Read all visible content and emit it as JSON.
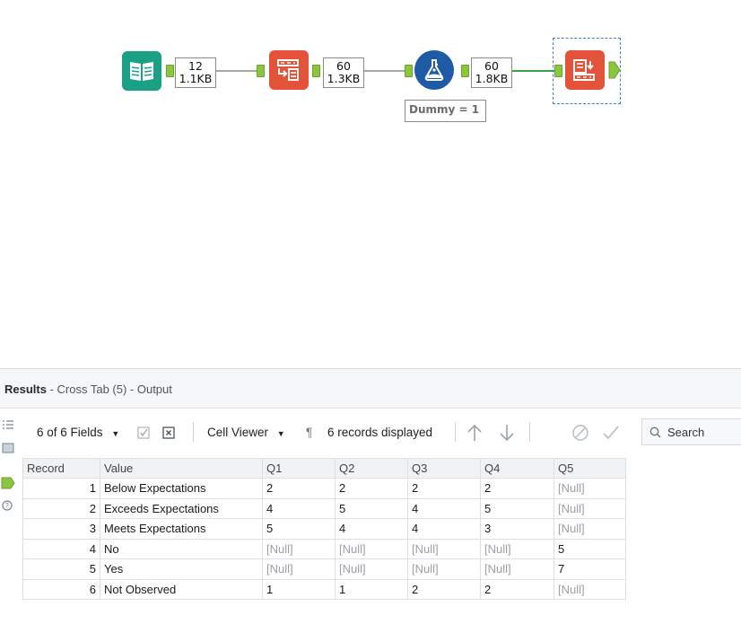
{
  "workflow": {
    "tools": [
      {
        "name": "Input Data",
        "icon": "book-icon",
        "color": "#1aa084"
      },
      {
        "name": "Cross Tab",
        "icon": "cross-tab-icon",
        "color": "#e2533a"
      },
      {
        "name": "Formula",
        "icon": "flask-icon",
        "color": "#1f5aa6"
      },
      {
        "name": "Cross Tab",
        "icon": "cross-tab-icon",
        "color": "#e2533a"
      }
    ],
    "badges": [
      {
        "records": "12",
        "size": "1.1KB"
      },
      {
        "records": "60",
        "size": "1.3KB"
      },
      {
        "records": "60",
        "size": "1.8KB"
      }
    ],
    "annotation": "Dummy = 1"
  },
  "results": {
    "title_bold": "Results",
    "title_rest": " - Cross Tab (5) - Output",
    "toolbar": {
      "fields": "6 of 6 Fields",
      "cell_viewer": "Cell Viewer",
      "pilcrow": "¶",
      "records_displayed": "6 records displayed",
      "search_placeholder": "Search"
    },
    "columns": [
      "Record",
      "Value",
      "Q1",
      "Q2",
      "Q3",
      "Q4",
      "Q5"
    ],
    "rows": [
      [
        "1",
        "Below Expectations",
        "2",
        "2",
        "2",
        "2",
        "[Null]"
      ],
      [
        "2",
        "Exceeds Expectations",
        "4",
        "5",
        "4",
        "5",
        "[Null]"
      ],
      [
        "3",
        "Meets Expectations",
        "5",
        "4",
        "4",
        "3",
        "[Null]"
      ],
      [
        "4",
        "No",
        "[Null]",
        "[Null]",
        "[Null]",
        "[Null]",
        "5"
      ],
      [
        "5",
        "Yes",
        "[Null]",
        "[Null]",
        "[Null]",
        "[Null]",
        "7"
      ],
      [
        "6",
        "Not Observed",
        "1",
        "1",
        "2",
        "2",
        "[Null]"
      ]
    ]
  },
  "colors": {
    "accent_green": "#8cc63f",
    "selected_connection": "#3aa34a",
    "null_text": "#9aa0a6"
  }
}
